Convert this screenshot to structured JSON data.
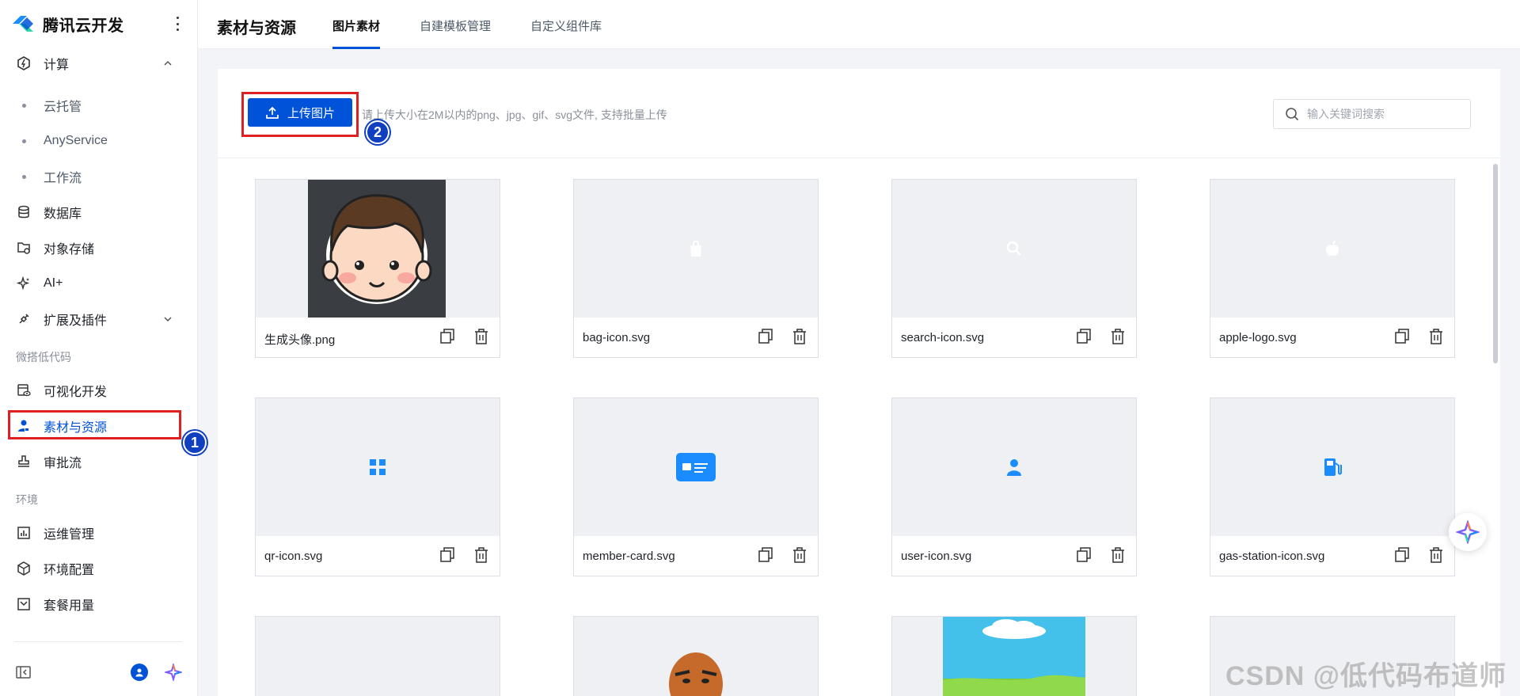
{
  "app": {
    "brand_name": "腾讯云开发"
  },
  "sidebar": {
    "items": [
      {
        "label": "计算",
        "icon": "compute-icon"
      },
      {
        "label": "云托管",
        "sub": true
      },
      {
        "label": "AnyService",
        "sub": true
      },
      {
        "label": "工作流",
        "sub": true
      },
      {
        "label": "数据库",
        "icon": "database-icon"
      },
      {
        "label": "对象存储",
        "icon": "storage-icon"
      },
      {
        "label": "AI+",
        "icon": "sparkle-icon"
      },
      {
        "label": "扩展及插件",
        "icon": "plugin-icon"
      },
      {
        "label": "可视化开发",
        "icon": "visual-dev-icon"
      },
      {
        "label": "素材与资源",
        "icon": "assets-icon",
        "active": true
      },
      {
        "label": "审批流",
        "icon": "approval-icon"
      },
      {
        "label": "运维管理",
        "icon": "ops-icon"
      },
      {
        "label": "环境配置",
        "icon": "env-config-icon"
      },
      {
        "label": "套餐用量",
        "icon": "usage-icon"
      }
    ],
    "groups": [
      "微搭低代码",
      "环境"
    ]
  },
  "header": {
    "title": "素材与资源",
    "tabs": [
      {
        "label": "图片素材",
        "active": true
      },
      {
        "label": "自建模板管理"
      },
      {
        "label": "自定义组件库"
      }
    ]
  },
  "toolbar": {
    "upload_label": "上传图片",
    "hint": "请上传大小在2M以内的png、jpg、gif、svg文件, 支持批量上传",
    "search_placeholder": "输入关键词搜索"
  },
  "assets": [
    {
      "name": "生成头像.png"
    },
    {
      "name": "bag-icon.svg"
    },
    {
      "name": "search-icon.svg"
    },
    {
      "name": "apple-logo.svg"
    },
    {
      "name": "qr-icon.svg"
    },
    {
      "name": "member-card.svg"
    },
    {
      "name": "user-icon.svg"
    },
    {
      "name": "gas-station-icon.svg"
    }
  ],
  "annotations": {
    "badge1": "1",
    "badge2": "2"
  },
  "watermark": "CSDN @低代码布道师",
  "colors": {
    "primary": "#0052d9",
    "annotation_red": "#e02020",
    "icon_blue": "#1a8cff"
  }
}
